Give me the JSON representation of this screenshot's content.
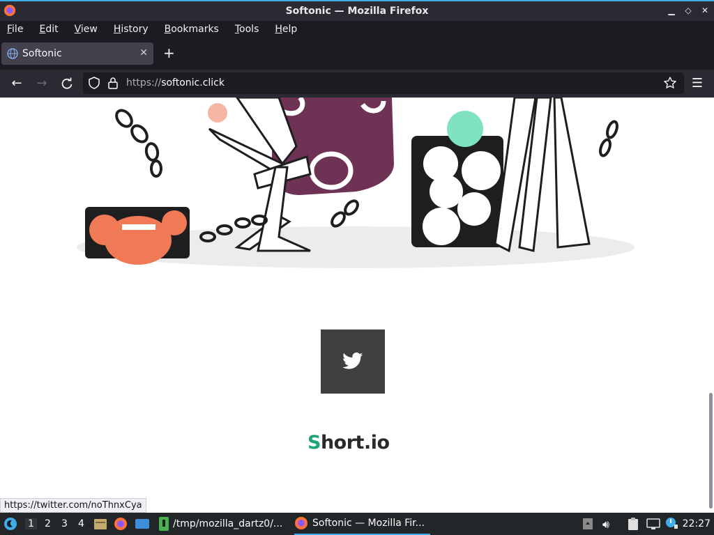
{
  "window": {
    "title": "Softonic — Mozilla Firefox"
  },
  "menu": [
    "File",
    "Edit",
    "View",
    "History",
    "Bookmarks",
    "Tools",
    "Help"
  ],
  "tab": {
    "label": "Softonic"
  },
  "urlbar": {
    "protocol": "https://",
    "host": "softonic.click"
  },
  "content": {
    "logo_s": "S",
    "logo_rest": "hort.io",
    "status_link": "https://twitter.com/noThnxCya"
  },
  "taskbar": {
    "workspaces": [
      "1",
      "2",
      "3",
      "4"
    ],
    "task_terminal": "/tmp/mozilla_dartz0/...",
    "task_firefox": "Softonic — Mozilla Fir...",
    "clock": "22:27"
  },
  "colors": {
    "accent": "#3daee9",
    "brand_green": "#1fa37a",
    "twitter_bg": "#404040"
  }
}
